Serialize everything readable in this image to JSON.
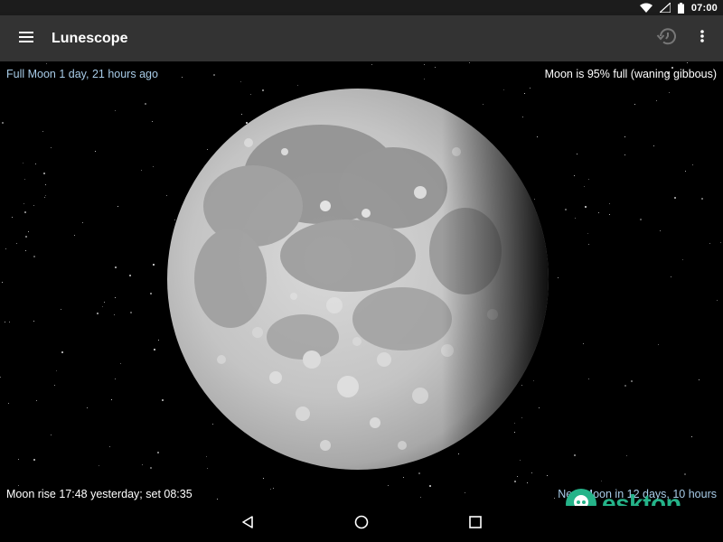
{
  "status_bar": {
    "time": "07:00",
    "icons": [
      "wifi-icon",
      "signal-icon",
      "battery-icon"
    ]
  },
  "app_bar": {
    "menu_icon": "hamburger-menu-icon",
    "title": "Lunescope",
    "history_icon": "history-icon",
    "overflow_icon": "more-vert-icon"
  },
  "info": {
    "top_left": "Full Moon 1 day, 21 hours ago",
    "top_right": "Moon is 95% full (waning gibbous)",
    "bottom_left": "Moon rise 17:48 yesterday; set 08:35",
    "bottom_right": "New Moon in 12 days, 10 hours"
  },
  "nav_bar": {
    "back_icon": "back-triangle-icon",
    "home_icon": "home-circle-icon",
    "recents_icon": "recents-square-icon"
  },
  "watermark": {
    "text": "Desktop"
  },
  "colors": {
    "status_bar": "#1c1c1c",
    "app_bar": "#333333",
    "accent_text": "#a8cce8",
    "watermark": "#25b389"
  }
}
